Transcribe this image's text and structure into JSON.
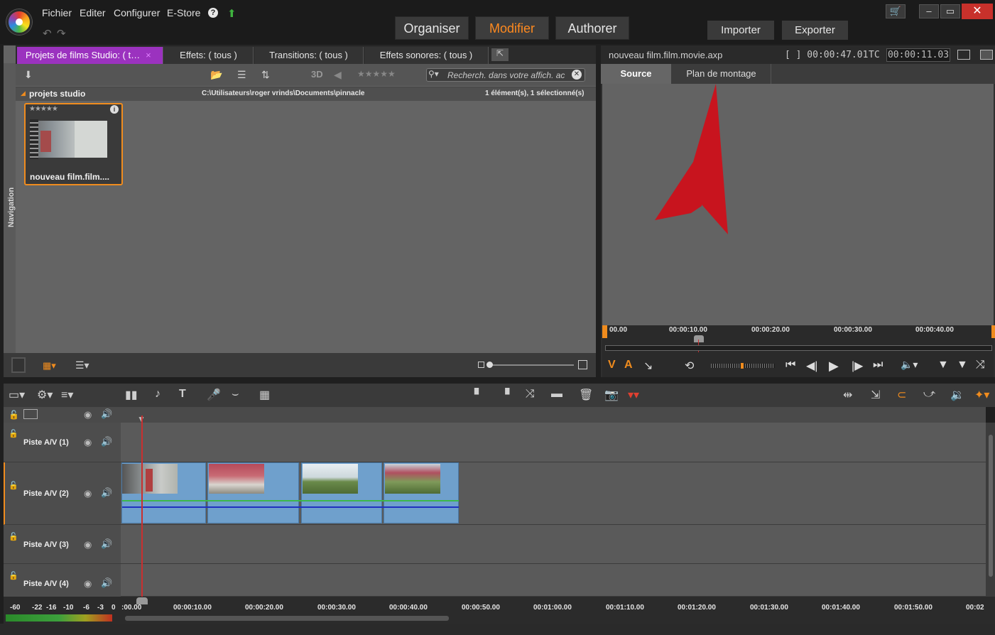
{
  "menu": [
    "Fichier",
    "Editer",
    "Configurer",
    "E-Store"
  ],
  "help_icon": "?",
  "modes": [
    "Organiser",
    "Modifier",
    "Authorer"
  ],
  "active_mode": "Modifier",
  "actions": [
    "Importer",
    "Exporter"
  ],
  "window_controls": [
    "cart-icon",
    "minimize-icon",
    "maximize-icon",
    "close-icon"
  ],
  "library": {
    "tabs": [
      {
        "label": "Projets de films Studio: ( t…",
        "close": "×"
      },
      {
        "label": "Effets: ( tous )"
      },
      {
        "label": "Transitions: ( tous )"
      },
      {
        "label": "Effets sonores: ( tous )"
      }
    ],
    "nav_label": "Navigation",
    "view3d": "3D",
    "search_placeholder": "Recherch. dans votre affich. ac",
    "folder": "projets studio",
    "path": "C:\\Utilisateurs\\roger vrinds\\Documents\\pinnacle",
    "count": "1 élément(s), 1 sélectionné(s)",
    "item_label": "nouveau film.film...."
  },
  "player": {
    "filename": "nouveau film.film.movie.axp",
    "duration": "[ ] 00:00:47.01",
    "tc_label": "TC",
    "tc_value": "00:00:11.03",
    "tabs": [
      "Source",
      "Plan de montage"
    ],
    "active_tab": "Source",
    "ruler": [
      "00.00",
      "00:00:10.00",
      "00:00:20.00",
      "00:00:30.00",
      "00:00:40.00"
    ],
    "v": "V",
    "a": "A"
  },
  "tracks": [
    "Piste A/V (1)",
    "Piste A/V (2)",
    "Piste A/V (3)",
    "Piste A/V (4)"
  ],
  "timeline_ruler": [
    ":00.00",
    "00:00:10.00",
    "00:00:20.00",
    "00:00:30.00",
    "00:00:40.00",
    "00:00:50.00",
    "00:01:00.00",
    "00:01:10.00",
    "00:01:20.00",
    "00:01:30.00",
    "00:01:40.00",
    "00:01:50.00",
    "00:02"
  ],
  "audio_meter": [
    "-60",
    "-22",
    "-16",
    "-10",
    "-6",
    "-3",
    "0"
  ],
  "colors": {
    "accent": "#ff8a1f",
    "tab_active": "#9b32bf",
    "clip": "#6fa0cc",
    "arrow": "#c8141e"
  }
}
